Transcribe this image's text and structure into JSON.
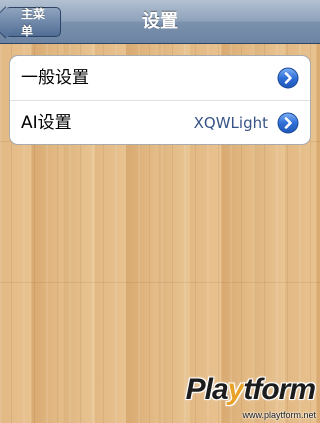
{
  "navbar": {
    "back_label": "主菜单",
    "title": "设置"
  },
  "settings": {
    "rows": [
      {
        "label": "一般设置",
        "value": ""
      },
      {
        "label": "AI设置",
        "value": "XQWLight"
      }
    ]
  },
  "icons": {
    "disclosure": "chevron-right-circle-icon",
    "back": "back-arrow-button"
  },
  "colors": {
    "navbar": "#7b91ad",
    "value_text": "#385487",
    "disclosure_blue": "#2f6fd6"
  },
  "watermark": {
    "brand": "Playtform",
    "brand_prefix": "Pla",
    "brand_accent": "y",
    "brand_suffix": "tform",
    "url": "www.playtform.net"
  }
}
